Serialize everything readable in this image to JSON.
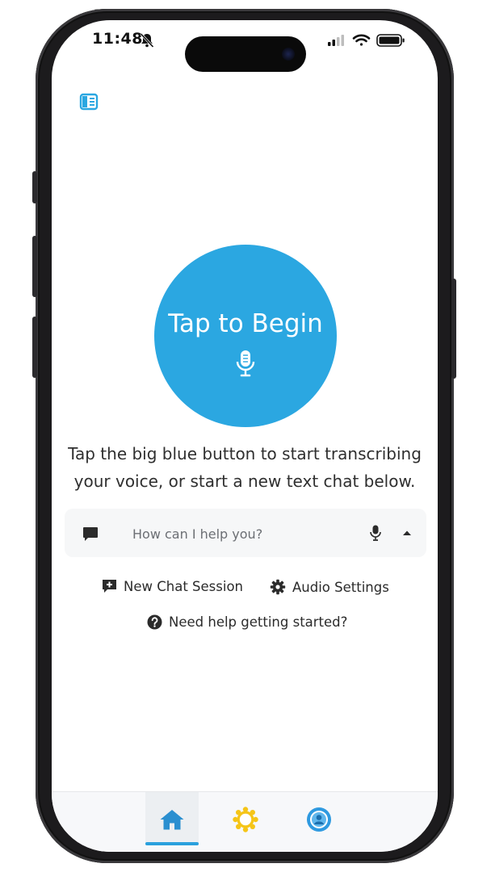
{
  "status_bar": {
    "time": "11:48",
    "icons": [
      "bell-slash-icon",
      "cellular-signal-icon",
      "wifi-icon",
      "battery-icon"
    ]
  },
  "header": {
    "sidebar_toggle_icon": "sidebar-panel-icon"
  },
  "main": {
    "begin_button_label": "Tap to Begin",
    "begin_button_icon": "microphone-icon",
    "intro_line1": "Tap the big blue button to start transcribing",
    "intro_line2": "your voice, or start a new text chat below."
  },
  "chat_bar": {
    "placeholder": "How can I help you?",
    "value": "",
    "icons": [
      "chat-bubble-icon",
      "microphone-icon",
      "caret-up-icon"
    ]
  },
  "actions": {
    "new_chat_label": "New Chat Session",
    "audio_settings_label": "Audio Settings",
    "help_label": "Need help getting started?"
  },
  "tabbar": {
    "tabs": [
      {
        "icon": "home-icon",
        "selected": true
      },
      {
        "icon": "sun-icon",
        "selected": false
      },
      {
        "icon": "profile-badge-icon",
        "selected": false
      }
    ]
  },
  "colors": {
    "accent": "#2ba7e1",
    "text": "#2f2f2f",
    "sun": "#f5c518"
  }
}
